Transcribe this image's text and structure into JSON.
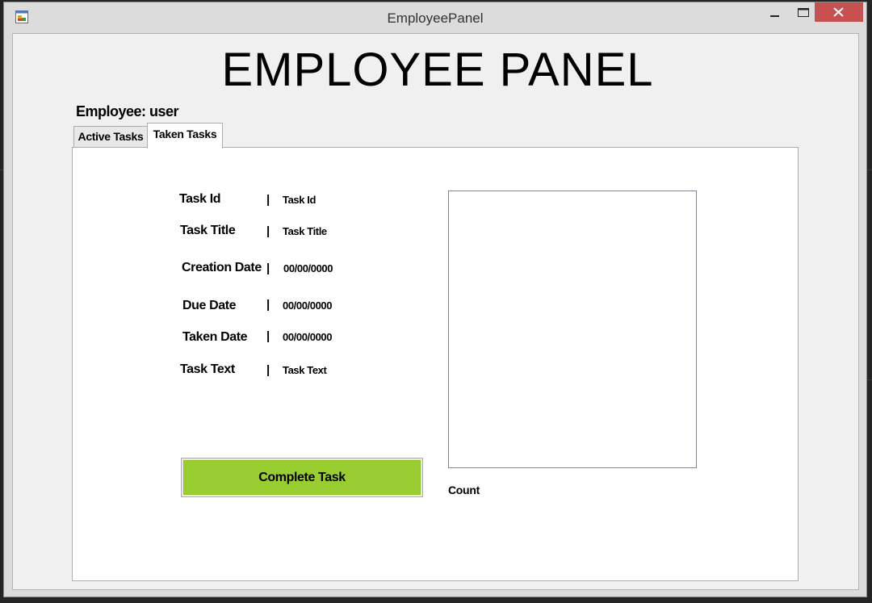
{
  "window": {
    "title": "EmployeePanel"
  },
  "header": {
    "panel_title": "EMPLOYEE PANEL",
    "employee_label": "Employee: user"
  },
  "tabs": [
    {
      "label": "Active Tasks",
      "selected": false
    },
    {
      "label": "Taken Tasks",
      "selected": true
    }
  ],
  "task_details": {
    "separator": "|",
    "fields": [
      {
        "label": "Task Id",
        "value": "Task Id"
      },
      {
        "label": "Task Title",
        "value": "Task Title"
      },
      {
        "label": "Creation Date",
        "value": "00/00/0000"
      },
      {
        "label": "Due Date",
        "value": "00/00/0000"
      },
      {
        "label": "Taken Date",
        "value": "00/00/0000"
      },
      {
        "label": "Task Text",
        "value": "Task Text"
      }
    ]
  },
  "actions": {
    "complete_label": "Complete Task"
  },
  "list": {
    "count_label": "Count"
  },
  "colors": {
    "complete_button": "#9acd32",
    "close_button": "#c75050"
  }
}
